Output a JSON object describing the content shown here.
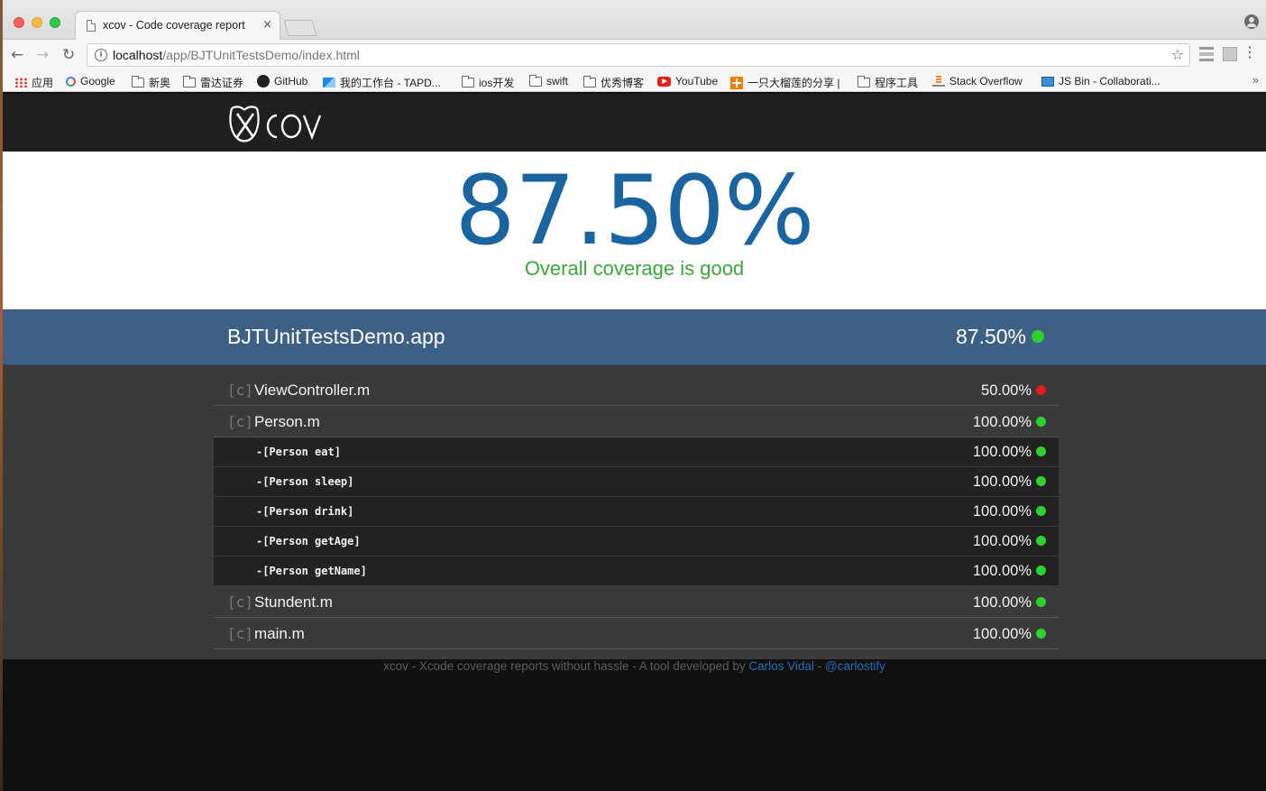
{
  "browser": {
    "tab_title": "xcov - Code coverage report",
    "tab_close": "×",
    "url_host": "localhost",
    "url_path": "/app/BJTUnitTestsDemo/index.html",
    "bookmarks": [
      {
        "label": "应用",
        "icon": "apps-icon"
      },
      {
        "label": "Google",
        "icon": "google-icon"
      },
      {
        "label": "新奥",
        "icon": "folder-icon"
      },
      {
        "label": "雷达证券",
        "icon": "folder-icon"
      },
      {
        "label": "GitHub",
        "icon": "github-icon"
      },
      {
        "label": "我的工作台 - TAPD...",
        "icon": "tapd-icon"
      },
      {
        "label": "ios开发",
        "icon": "folder-icon"
      },
      {
        "label": "swift",
        "icon": "folder-icon"
      },
      {
        "label": "优秀博客",
        "icon": "folder-icon"
      },
      {
        "label": "YouTube",
        "icon": "youtube-icon"
      },
      {
        "label": "一只大榴莲的分享 |",
        "icon": "plus-icon"
      },
      {
        "label": "程序工具",
        "icon": "folder-icon"
      },
      {
        "label": "Stack Overflow",
        "icon": "stackoverflow-icon"
      },
      {
        "label": "JS Bin - Collaborati...",
        "icon": "jsbin-icon"
      }
    ],
    "bookmarks_more": "»"
  },
  "report": {
    "logo_text": "XCOV",
    "overall_coverage": "87.50%",
    "overall_status": "Overall coverage is good",
    "target": {
      "name": "BJTUnitTestsDemo.app",
      "coverage": "87.50%",
      "status_color": "#2ed22e"
    },
    "files": [
      {
        "tag": "[c]",
        "name": "ViewController.m",
        "coverage": "50.00%",
        "status_color": "#e21b1b",
        "methods": []
      },
      {
        "tag": "[c]",
        "name": "Person.m",
        "coverage": "100.00%",
        "status_color": "#2ed22e",
        "methods": [
          {
            "name": "-[Person eat]",
            "coverage": "100.00%"
          },
          {
            "name": "-[Person sleep]",
            "coverage": "100.00%"
          },
          {
            "name": "-[Person drink]",
            "coverage": "100.00%"
          },
          {
            "name": "-[Person getAge]",
            "coverage": "100.00%"
          },
          {
            "name": "-[Person getName]",
            "coverage": "100.00%"
          }
        ]
      },
      {
        "tag": "[c]",
        "name": "Stundent.m",
        "coverage": "100.00%",
        "status_color": "#2ed22e",
        "methods": []
      },
      {
        "tag": "[c]",
        "name": "main.m",
        "coverage": "100.00%",
        "status_color": "#2ed22e",
        "methods": []
      }
    ],
    "footer": {
      "text": "xcov - Xcode coverage reports without hassle - A tool developed by ",
      "author": "Carlos Vidal",
      "separator": " - ",
      "handle": "@carlostify"
    }
  },
  "colors": {
    "hero_blue": "#1a64a0",
    "good_green": "#3aa83a",
    "target_bar": "#3d6185"
  }
}
